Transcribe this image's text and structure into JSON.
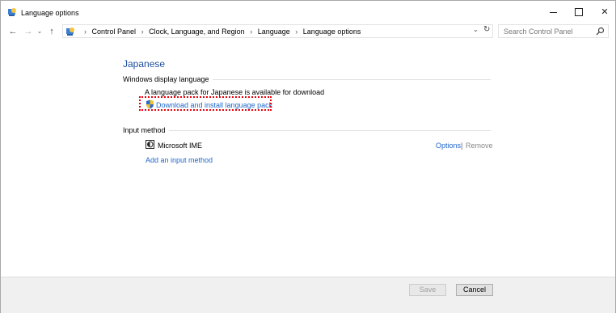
{
  "window": {
    "title": "Language options",
    "icon": "control-panel-icon",
    "controls": {
      "minimize": "minimize-icon",
      "maximize": "maximize-icon",
      "close": "close-icon"
    }
  },
  "nav": {
    "back": "←",
    "forward": "→",
    "recent": "⌄",
    "up": "↑"
  },
  "address": {
    "crumbs": [
      "Control Panel",
      "Clock, Language, and Region",
      "Language",
      "Language options"
    ],
    "separator": "›",
    "dropdown": "⌄",
    "refresh": "↻"
  },
  "search": {
    "placeholder": "Search Control Panel",
    "icon": "search-icon"
  },
  "content": {
    "language_name": "Japanese",
    "display_section": {
      "title": "Windows display language",
      "message": "A language pack for Japanese is available for download",
      "download_link": "Download and install language pack",
      "highlight_color": "#e8000b"
    },
    "input_section": {
      "title": "Input method",
      "methods": [
        {
          "name": "Microsoft IME",
          "options_label": "Options",
          "separator": "|",
          "remove_label": "Remove"
        }
      ],
      "add_link": "Add an input method"
    }
  },
  "footer": {
    "save_label": "Save",
    "cancel_label": "Cancel"
  },
  "colors": {
    "accent": "#1e66c9",
    "heading": "#1e4e9c"
  }
}
